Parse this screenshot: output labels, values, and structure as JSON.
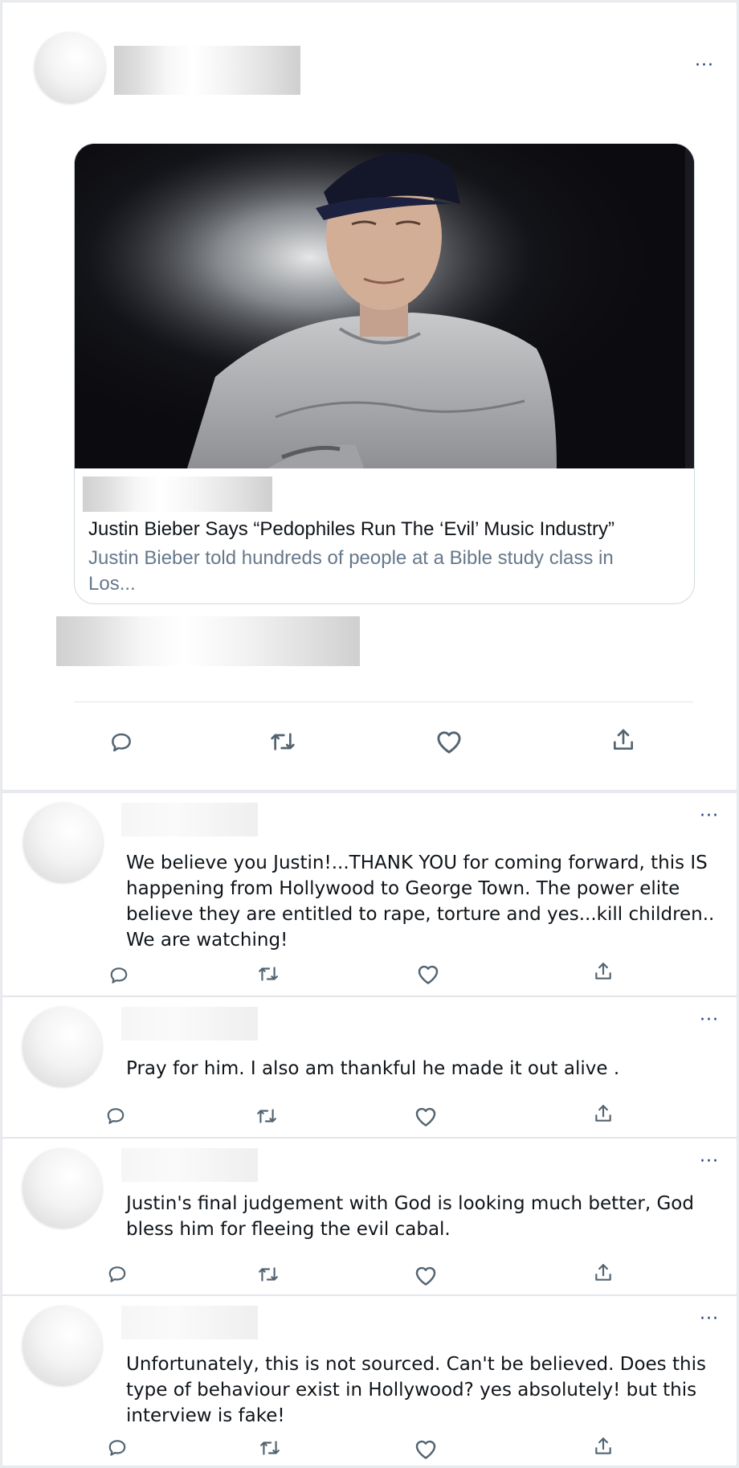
{
  "main_tweet": {
    "more_label": "···",
    "card": {
      "title": "Justin Bieber Says “Pedophiles Run The ‘Evil’ Music Industry”",
      "description": "Justin Bieber told hundreds of people at a Bible study class in Los..."
    },
    "actions": {
      "reply_icon": "speech-bubble-icon",
      "retweet_icon": "retweet-icon",
      "like_icon": "heart-icon",
      "share_icon": "share-upload-icon"
    }
  },
  "replies": [
    {
      "more_label": "···",
      "text": "We believe you Justin!...THANK YOU for coming forward, this IS happening from Hollywood to George Town. The power elite believe they are entitled to rape, torture and yes...kill children.. We are watching!"
    },
    {
      "more_label": "···",
      "text": "Pray for him. I also am thankful he made it out alive ."
    },
    {
      "more_label": "···",
      "text": "Justin's final judgement with God is looking much better, God bless him for fleeing the evil cabal."
    },
    {
      "more_label": "···",
      "text": "Unfortunately, this is not sourced. Can't be believed. Does this type of behaviour exist in Hollywood? yes absolutely! but this interview is fake!"
    }
  ]
}
